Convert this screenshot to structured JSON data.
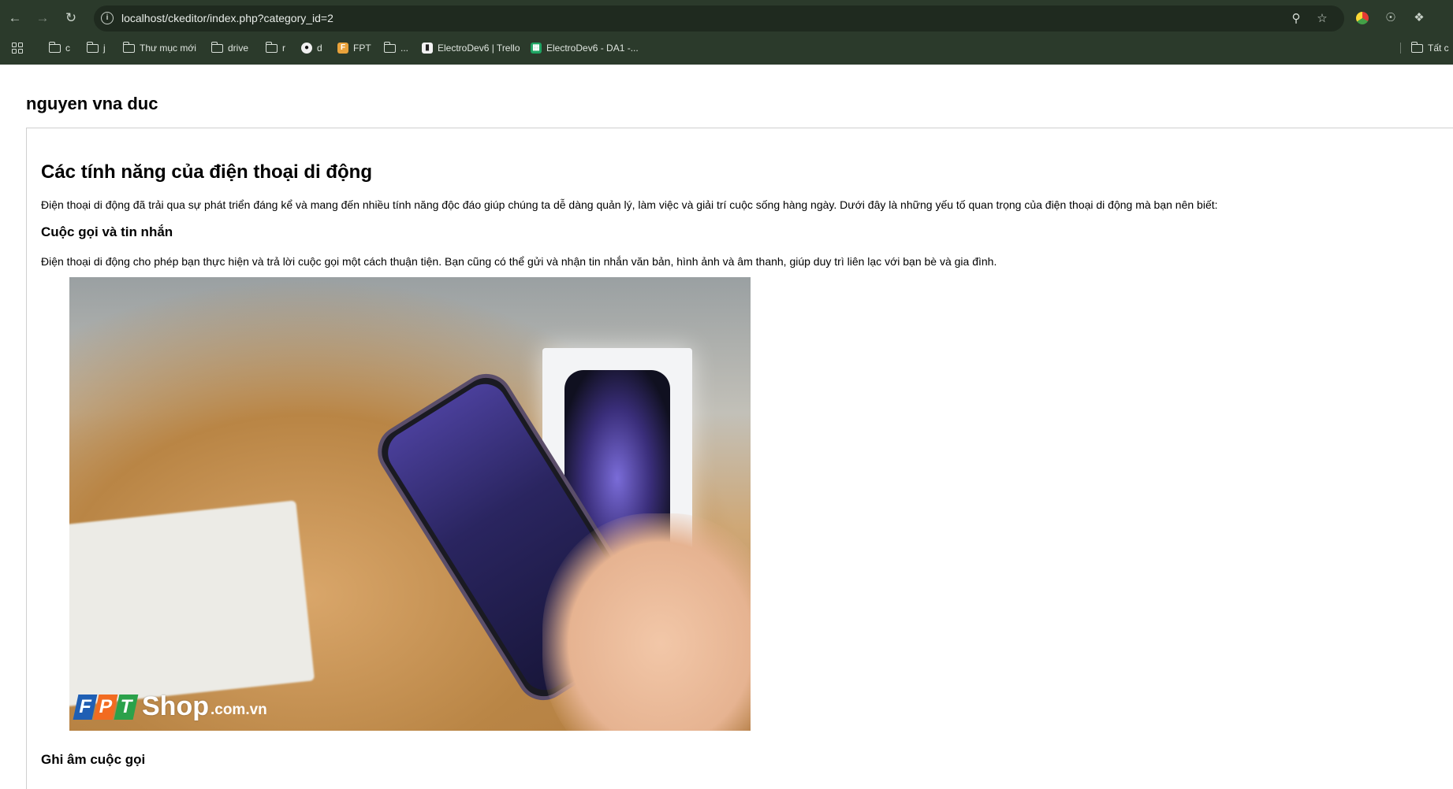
{
  "browser": {
    "url": "localhost/ckeditor/index.php?category_id=2",
    "bookmarks": [
      {
        "label": "c",
        "icon": "folder-icon"
      },
      {
        "label": "j",
        "icon": "folder-icon"
      },
      {
        "label": "Thư mục mới",
        "icon": "folder-icon"
      },
      {
        "label": "drive",
        "icon": "folder-icon"
      },
      {
        "label": "r",
        "icon": "folder-icon"
      },
      {
        "label": "d",
        "icon": "github-icon"
      },
      {
        "label": "FPT",
        "icon": "fpt-icon"
      },
      {
        "label": "...",
        "icon": "folder-icon"
      },
      {
        "label": "ElectroDev6 | Trello",
        "icon": "trello-icon"
      },
      {
        "label": "ElectroDev6 - DA1 -...",
        "icon": "sheets-icon"
      },
      {
        "label": "Tất c",
        "icon": "folder-icon"
      }
    ]
  },
  "page": {
    "site_title": "nguyen vna duc",
    "article": {
      "heading": "Các tính năng của điện thoại di động",
      "intro": "Điện thoại di động đã trải qua sự phát triển đáng kể và mang đến nhiều tính năng độc đáo giúp chúng ta dễ dàng quản lý, làm việc và giải trí cuộc sống hàng ngày. Dưới đây là những yếu tố quan trọng của điện thoại di động mà bạn nên biết:",
      "section1_heading": "Cuộc gọi và tin nhắn",
      "section1_text": "Điện thoại di động cho phép bạn thực hiện và trả lời cuộc gọi một cách thuận tiện. Bạn cũng có thể gửi và nhận tin nhắn văn bản, hình ảnh và âm thanh, giúp duy trì liên lạc với bạn bè và gia đình.",
      "image_watermark": {
        "brand_letters": [
          "F",
          "P",
          "T"
        ],
        "shop": "Shop",
        "domain": ".com.vn"
      },
      "section2_heading": "Ghi âm cuộc gọi"
    }
  },
  "colors": {
    "chrome_bg": "#2b3a2b",
    "omnibox_bg": "#1f2a1f",
    "fpt_blue": "#1f5fb4",
    "fpt_orange": "#f26b21",
    "fpt_green": "#2ba14a"
  }
}
